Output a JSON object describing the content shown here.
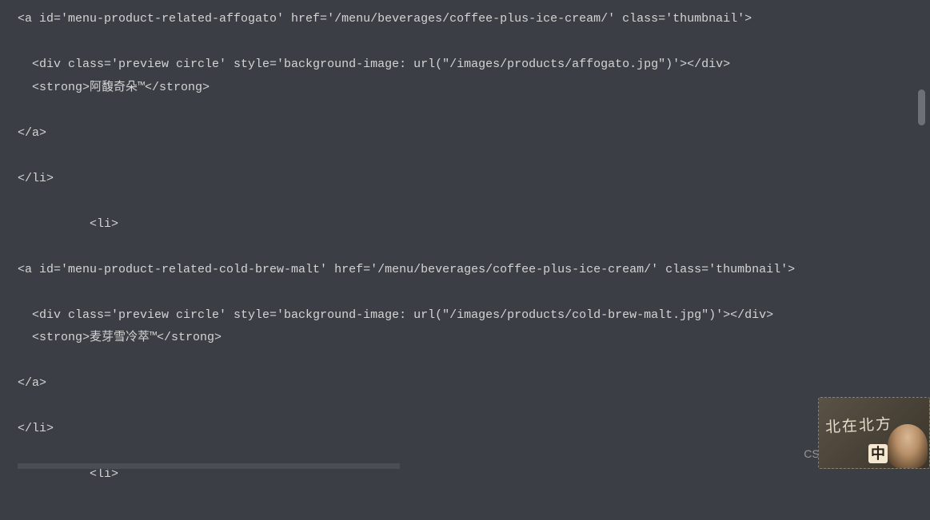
{
  "code_lines": [
    "<a id='menu-product-related-affogato' href='/menu/beverages/coffee-plus-ice-cream/' class='thumbnail'>",
    "",
    "  <div class='preview circle' style='background-image: url(\"/images/products/affogato.jpg\")'></div>",
    "  <strong>阿馥奇朵™</strong>",
    "",
    "</a>",
    "",
    "</li>",
    "",
    "          <li>",
    "",
    "<a id='menu-product-related-cold-brew-malt' href='/menu/beverages/coffee-plus-ice-cream/' class='thumbnail'>",
    "",
    "  <div class='preview circle' style='background-image: url(\"/images/products/cold-brew-malt.jpg\")'></div>",
    "  <strong>麦芽雪冷萃™</strong>",
    "",
    "</a>",
    "",
    "</li>",
    "",
    "          <li>"
  ],
  "watermark": "CSDN @是Dream呀",
  "avatar": {
    "line1": "北在北方",
    "badge": "中"
  }
}
